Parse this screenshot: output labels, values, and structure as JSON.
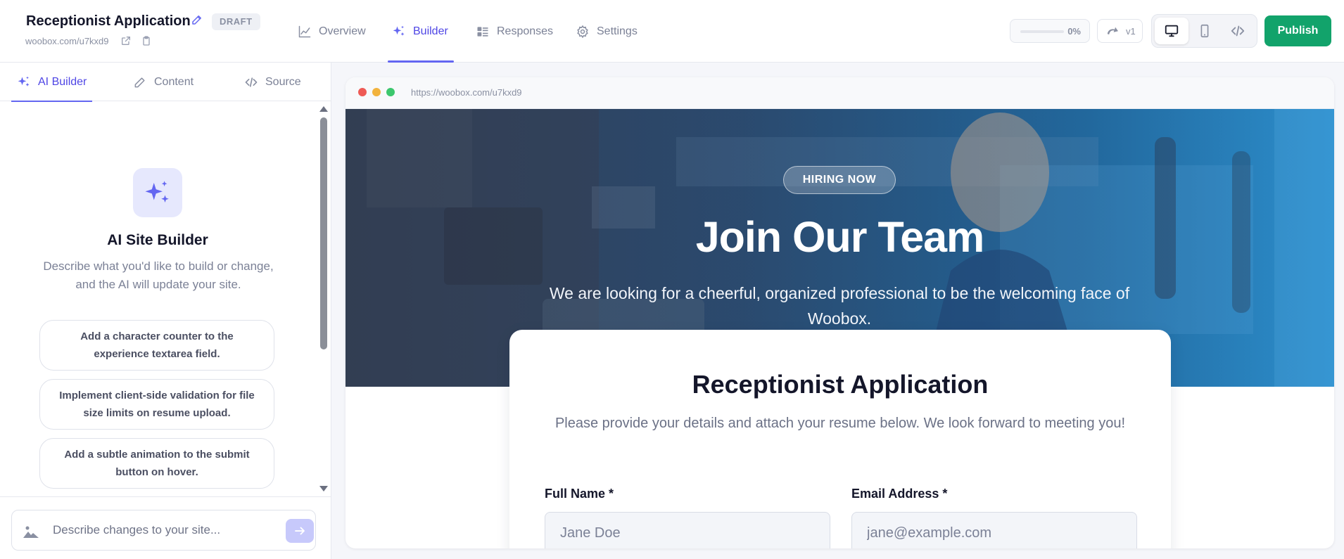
{
  "header": {
    "app_title": "Receptionist Application",
    "status_badge": "DRAFT",
    "site_url": "woobox.com/u7kxd9",
    "nav_tabs": [
      {
        "label": "Overview",
        "icon": "chart-line-icon",
        "active": false
      },
      {
        "label": "Builder",
        "icon": "sparkles-icon",
        "active": true
      },
      {
        "label": "Responses",
        "icon": "list-icon",
        "active": false
      },
      {
        "label": "Settings",
        "icon": "gear-icon",
        "active": false
      }
    ],
    "progress": {
      "value": 0,
      "label": "0%"
    },
    "version": {
      "label": "v1",
      "icon": "undo-icon"
    },
    "device_modes": [
      {
        "name": "desktop",
        "icon": "monitor-icon",
        "active": true
      },
      {
        "name": "mobile",
        "icon": "phone-icon",
        "active": false
      },
      {
        "name": "code",
        "icon": "code-icon",
        "active": false
      }
    ],
    "publish_label": "Publish"
  },
  "left_panel": {
    "tabs": [
      {
        "label": "AI Builder",
        "icon": "sparkles-icon",
        "active": true
      },
      {
        "label": "Content",
        "icon": "pencil-icon",
        "active": false
      },
      {
        "label": "Source",
        "icon": "code-icon",
        "active": false
      }
    ],
    "ai_builder": {
      "title": "AI Site Builder",
      "description": "Describe what you'd like to build or change, and the AI will update your site.",
      "suggestions": [
        "Add a character counter to the experience textarea field.",
        "Implement client-side validation for file size limits on resume upload.",
        "Add a subtle animation to the submit button on hover."
      ]
    },
    "chat": {
      "placeholder": "Describe changes to your site...",
      "value": ""
    }
  },
  "preview": {
    "browser_url": "https://woobox.com/u7kxd9",
    "hero": {
      "badge": "HIRING NOW",
      "title": "Join Our Team",
      "subtitle": "We are looking for a cheerful, organized professional to be the welcoming face of Woobox."
    },
    "form": {
      "title": "Receptionist Application",
      "description": "Please provide your details and attach your resume below. We look forward to meeting you!",
      "fields": [
        {
          "label": "Full Name *",
          "placeholder": "Jane Doe",
          "value": ""
        },
        {
          "label": "Email Address *",
          "placeholder": "jane@example.com",
          "value": ""
        }
      ]
    }
  },
  "colors": {
    "accent": "#4f46e5",
    "publish": "#12a36b",
    "hero_left": "#36455e",
    "hero_right": "#2d8fcc"
  }
}
